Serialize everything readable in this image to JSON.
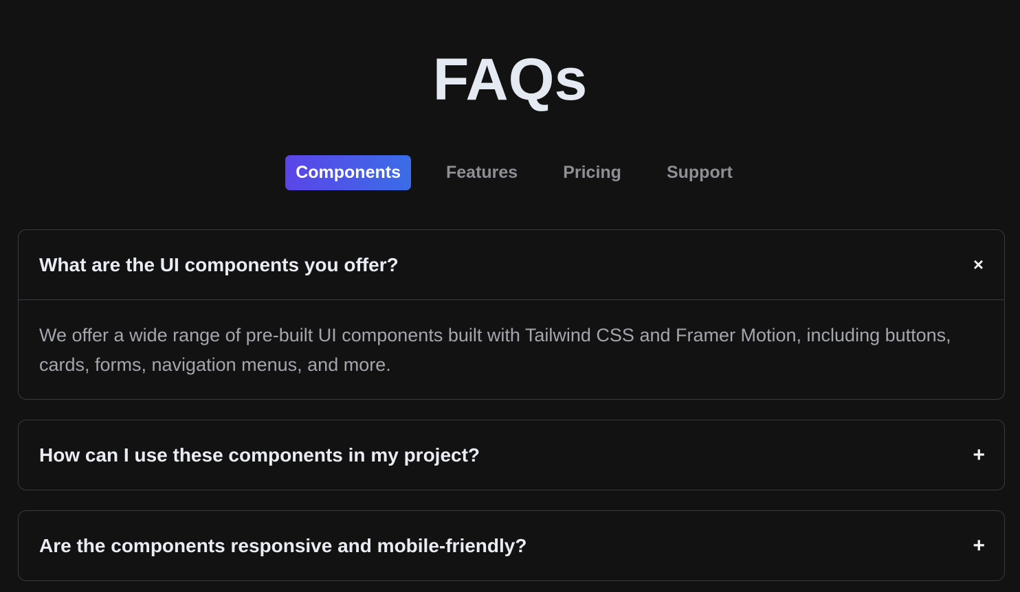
{
  "page": {
    "title": "FAQs"
  },
  "tabs": [
    {
      "label": "Components",
      "active": true
    },
    {
      "label": "Features",
      "active": false
    },
    {
      "label": "Pricing",
      "active": false
    },
    {
      "label": "Support",
      "active": false
    }
  ],
  "faqs": [
    {
      "question": "What are the UI components you offer?",
      "expanded": true,
      "toggle_icon": "×",
      "answer": "We offer a wide range of pre-built UI components built with Tailwind CSS and Framer Motion, including buttons, cards, forms, navigation menus, and more."
    },
    {
      "question": "How can I use these components in my project?",
      "expanded": false,
      "toggle_icon": "+"
    },
    {
      "question": "Are the components responsive and mobile-friendly?",
      "expanded": false,
      "toggle_icon": "+"
    }
  ],
  "colors": {
    "background": "#121213",
    "accent_start": "#5b45e8",
    "accent_end": "#3a6de7",
    "text_primary": "#e9ecf2",
    "text_muted": "#a3a6ad",
    "border": "#3a3b3e"
  }
}
